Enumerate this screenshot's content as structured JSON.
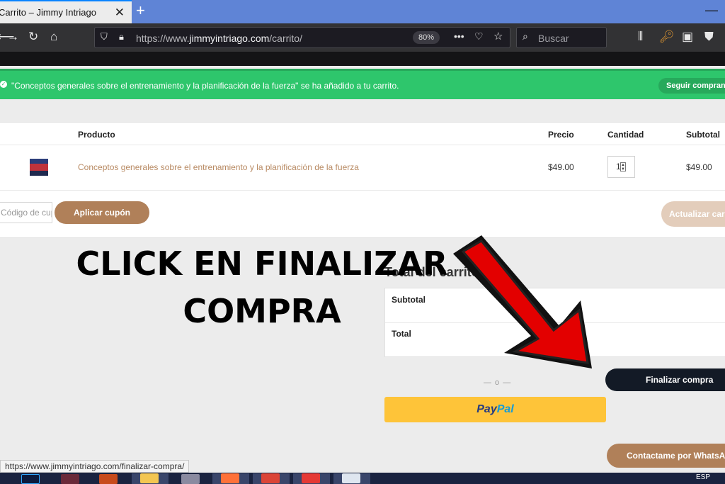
{
  "browser": {
    "tab_title": "Carrito – Jimmy Intriago",
    "tab_close": "✕",
    "new_tab": "+",
    "url_prefix": "https://www.",
    "url_domain": "jimmyintriago.com",
    "url_path": "/carrito/",
    "zoom": "80%",
    "search_placeholder": "Buscar",
    "status_url": "https://www.jimmyintriago.com/finalizar-compra/"
  },
  "notice": {
    "message": "\"Conceptos generales sobre el entrenamiento y la planificación de la fuerza\" se ha añadido a tu carrito.",
    "continue_label": "Seguir comprando"
  },
  "cart": {
    "headers": {
      "product": "Producto",
      "price": "Precio",
      "quantity": "Cantidad",
      "subtotal": "Subtotal"
    },
    "items": [
      {
        "name": "Conceptos generales sobre el entrenamiento y la planificación de la fuerza",
        "price": "$49.00",
        "quantity": "1",
        "subtotal": "$49.00"
      }
    ],
    "coupon_placeholder": "Código de cupón",
    "apply_coupon": "Aplicar cupón",
    "update_cart": "Actualizar carrito"
  },
  "totals": {
    "heading": "Total del carrito",
    "subtotal_label": "Subtotal",
    "total_label": "Total",
    "or_separator": "— o —",
    "checkout": "Finalizar compra",
    "paypal_pay": "Pay",
    "paypal_pal": "Pal",
    "whatsapp": "Contactame por WhatsApp"
  },
  "overlay": {
    "line1": "CLICK EN FINALIZAR",
    "line2": "COMPRA",
    "arrow_color": "#e30000"
  },
  "taskbar": {
    "language": "ESP"
  }
}
